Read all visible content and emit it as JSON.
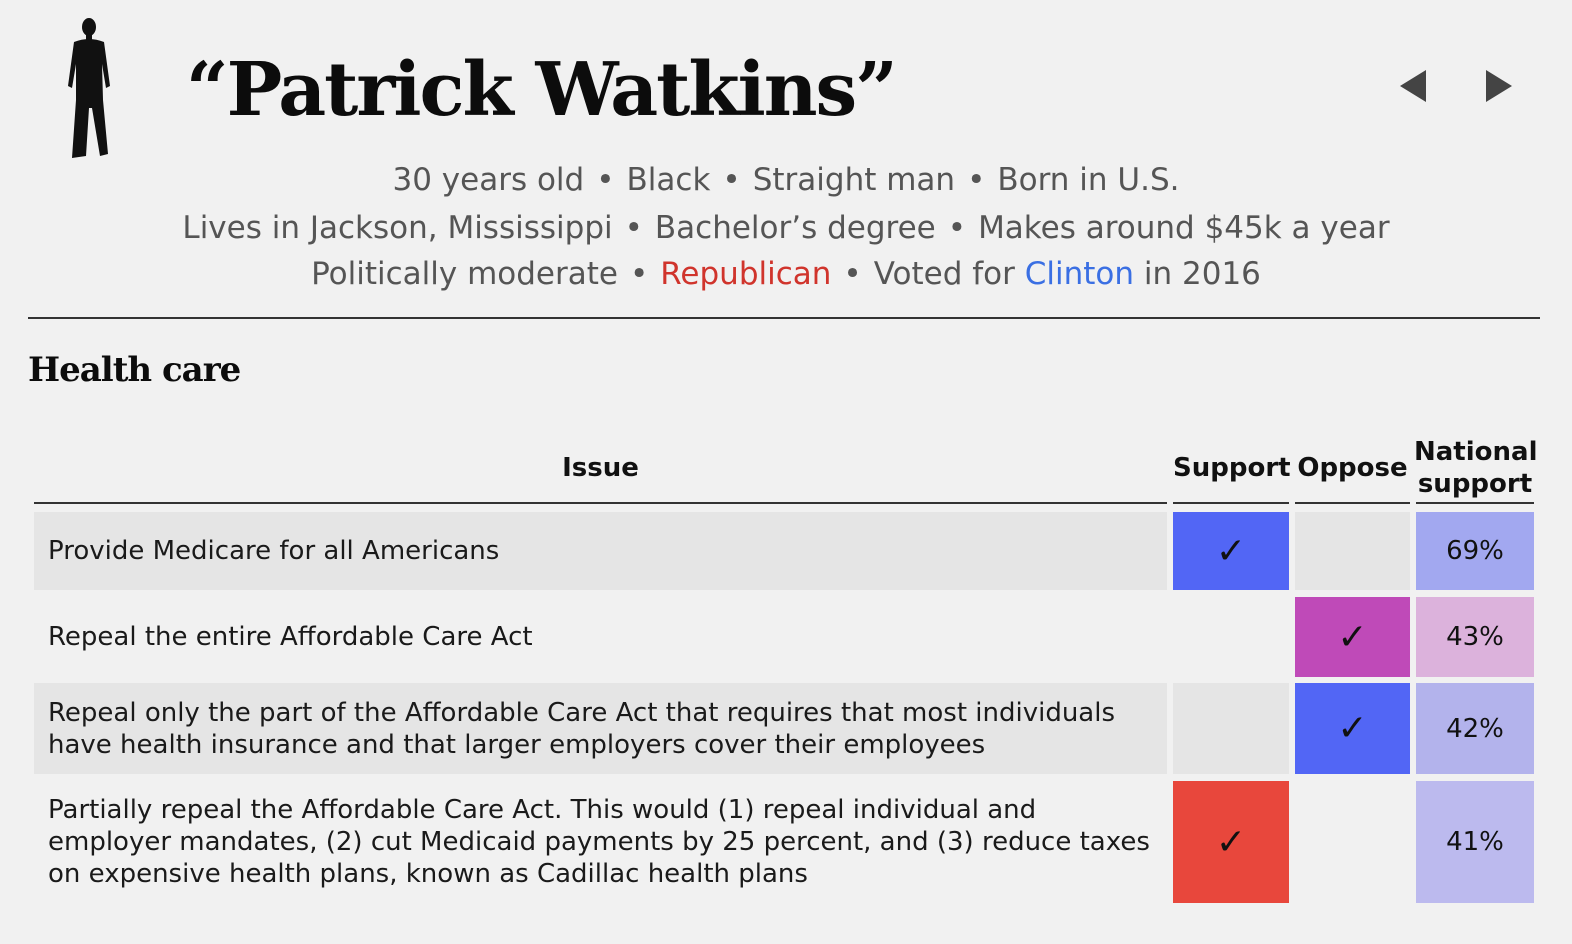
{
  "profile": {
    "name": "“Patrick Watkins”",
    "bio": {
      "age": "30 years old",
      "race": "Black",
      "identity": "Straight man",
      "birthplace": "Born in U.S.",
      "residence": "Lives in Jackson, Mississippi",
      "education": "Bachelor’s degree",
      "income": "Makes around $45k a year",
      "ideology": "Politically moderate",
      "party": "Republican",
      "vote_prefix": "Voted for",
      "vote_candidate": "Clinton",
      "vote_suffix": "in 2016"
    },
    "separator": "•"
  },
  "section": {
    "title": "Health care"
  },
  "table": {
    "headers": {
      "issue": "Issue",
      "support": "Support",
      "oppose": "Oppose",
      "national_line1": "National",
      "national_line2": "support"
    },
    "rows": [
      {
        "issue": "Provide Medicare for all Americans",
        "choice": "support",
        "national": "69%"
      },
      {
        "issue": "Repeal the entire Affordable Care Act",
        "choice": "oppose",
        "national": "43%"
      },
      {
        "issue": "Repeal only the part of the Affordable Care Act that requires that most individuals have health insurance and that larger employers cover their employees",
        "choice": "oppose",
        "national": "42%"
      },
      {
        "issue": "Partially repeal the Affordable Care Act. This would (1) repeal individual and employer mandates, (2) cut Medicaid payments by 25 percent, and (3) reduce taxes on expensive health plans, known as Cadillac health plans",
        "choice": "support",
        "national": "41%"
      }
    ],
    "check_mark": "✓"
  },
  "colors": {
    "republican": "#d0342c",
    "democrat_vote": "#3a6fe3",
    "support_cell_row1": "#5266f5",
    "oppose_cell_row2": "#bf4ab8",
    "oppose_cell_row3": "#5266f5",
    "support_cell_row4": "#e8473c",
    "national_row1": "#a2a8f0",
    "national_row2": "#dcb2dc",
    "national_row3": "#b3b3ec",
    "national_row4": "#bcbaee"
  }
}
